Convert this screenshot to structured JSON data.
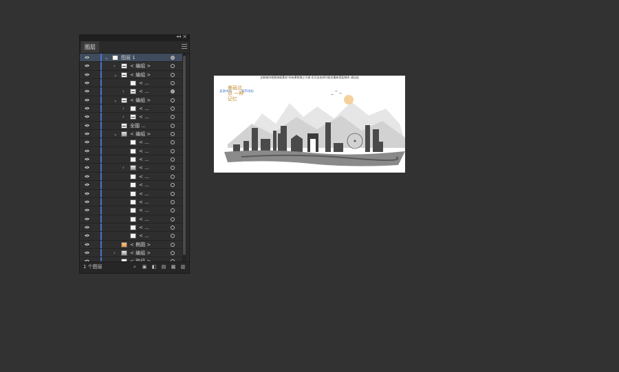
{
  "panel": {
    "title": "图层",
    "collapse_glyph": "◂◂",
    "close_glyph": "✕",
    "footer_count": "1 个图层",
    "rows": [
      {
        "depth": 0,
        "expand": "open",
        "thumb": "blank",
        "label": "图层 1",
        "selected": true,
        "target": "filled"
      },
      {
        "depth": 1,
        "expand": "closed",
        "thumb": "line",
        "label": "< 编组 >",
        "selected": false,
        "target": "empty"
      },
      {
        "depth": 1,
        "expand": "open",
        "thumb": "line",
        "label": "< 编组 >",
        "selected": false,
        "target": "empty"
      },
      {
        "depth": 2,
        "expand": "none",
        "thumb": "blank",
        "label": "< ...",
        "selected": false,
        "target": "empty"
      },
      {
        "depth": 2,
        "expand": "closed",
        "thumb": "line",
        "label": "< ...",
        "selected": false,
        "target": "filled"
      },
      {
        "depth": 1,
        "expand": "open",
        "thumb": "line",
        "label": "< 编组 >",
        "selected": false,
        "target": "empty"
      },
      {
        "depth": 2,
        "expand": "closed",
        "thumb": "blank",
        "label": "< ...",
        "selected": false,
        "target": "empty"
      },
      {
        "depth": 2,
        "expand": "closed",
        "thumb": "line",
        "label": "< ...",
        "selected": false,
        "target": "empty"
      },
      {
        "depth": 1,
        "expand": "none",
        "thumb": "line",
        "label": "全國 ...",
        "selected": false,
        "target": "empty"
      },
      {
        "depth": 1,
        "expand": "open",
        "thumb": "img",
        "label": "< 编组 >",
        "selected": false,
        "target": "empty"
      },
      {
        "depth": 2,
        "expand": "none",
        "thumb": "blank",
        "label": "< ...",
        "selected": false,
        "target": "empty"
      },
      {
        "depth": 2,
        "expand": "none",
        "thumb": "blank",
        "label": "< ...",
        "selected": false,
        "target": "empty"
      },
      {
        "depth": 2,
        "expand": "none",
        "thumb": "blank",
        "label": "< ...",
        "selected": false,
        "target": "empty"
      },
      {
        "depth": 2,
        "expand": "closed",
        "thumb": "img",
        "label": "< ...",
        "selected": false,
        "target": "empty"
      },
      {
        "depth": 2,
        "expand": "none",
        "thumb": "blank",
        "label": "< ...",
        "selected": false,
        "target": "empty"
      },
      {
        "depth": 2,
        "expand": "none",
        "thumb": "blank",
        "label": "< ...",
        "selected": false,
        "target": "empty"
      },
      {
        "depth": 2,
        "expand": "none",
        "thumb": "blank",
        "label": "< ...",
        "selected": false,
        "target": "empty"
      },
      {
        "depth": 2,
        "expand": "none",
        "thumb": "blank",
        "label": "< ...",
        "selected": false,
        "target": "empty"
      },
      {
        "depth": 2,
        "expand": "none",
        "thumb": "blank",
        "label": "< ...",
        "selected": false,
        "target": "empty"
      },
      {
        "depth": 2,
        "expand": "none",
        "thumb": "blank",
        "label": "< ...",
        "selected": false,
        "target": "empty"
      },
      {
        "depth": 2,
        "expand": "none",
        "thumb": "blank",
        "label": "< ...",
        "selected": false,
        "target": "empty"
      },
      {
        "depth": 2,
        "expand": "none",
        "thumb": "blank",
        "label": "< ...",
        "selected": false,
        "target": "empty"
      },
      {
        "depth": 1,
        "expand": "none",
        "thumb": "orange",
        "label": "< 椭圆 >",
        "selected": false,
        "target": "empty"
      },
      {
        "depth": 1,
        "expand": "closed",
        "thumb": "img",
        "label": "< 编组 >",
        "selected": false,
        "target": "empty"
      },
      {
        "depth": 1,
        "expand": "none",
        "thumb": "blank",
        "label": "< 路径 >",
        "selected": false,
        "target": "empty",
        "locked": true
      }
    ],
    "footer_icons": [
      "search-icon",
      "export-icon",
      "clip-mask-icon",
      "sublayer-icon",
      "new-layer-icon",
      "trash-icon"
    ]
  },
  "artboard": {
    "caption": "全新城市地图海报素材 所有建筑独立可调 也可自由排列组合重新搭配城市 请自由",
    "tag_left": "美丽中国",
    "tag_right": "城市地标",
    "calligraphy": "美丽北京 一种记忆",
    "accent_color": "#c28a2c"
  }
}
